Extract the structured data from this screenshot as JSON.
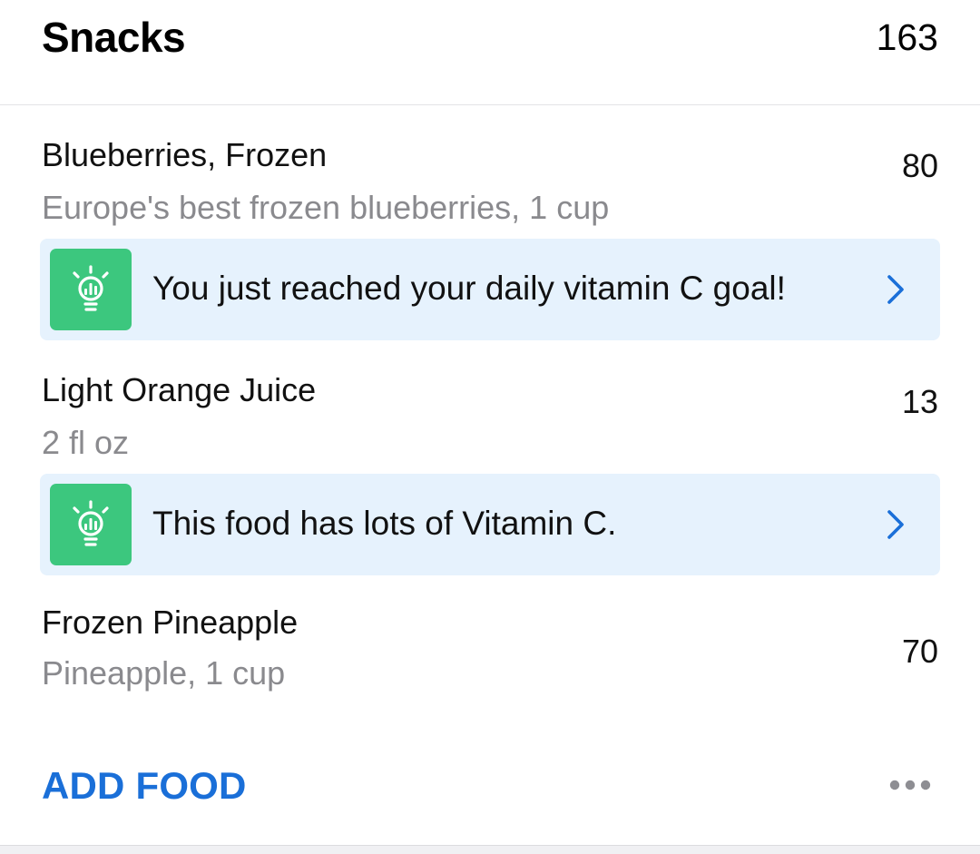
{
  "header": {
    "title": "Snacks",
    "total_calories": "163"
  },
  "foods": [
    {
      "name": "Blueberries, Frozen",
      "description": "Europe's best frozen blueberries, 1 cup",
      "calories": "80",
      "tip": "You just reached your daily vitamin C goal!"
    },
    {
      "name": "Light Orange Juice",
      "description": "2 fl oz",
      "calories": "13",
      "tip": "This food has lots of Vitamin C."
    },
    {
      "name": "Frozen Pineapple",
      "description": "Pineapple, 1 cup",
      "calories": "70"
    }
  ],
  "footer": {
    "add_food_label": "ADD FOOD"
  },
  "icons": {
    "tip": "lightbulb-icon",
    "tip_action": "chevron-right-icon",
    "more": "more-horizontal-icon"
  },
  "colors": {
    "accent": "#1a6fd8",
    "tip_background": "#e6f2fd",
    "tip_icon_background": "#3cc77e",
    "secondary_text": "#8a8a8e"
  }
}
